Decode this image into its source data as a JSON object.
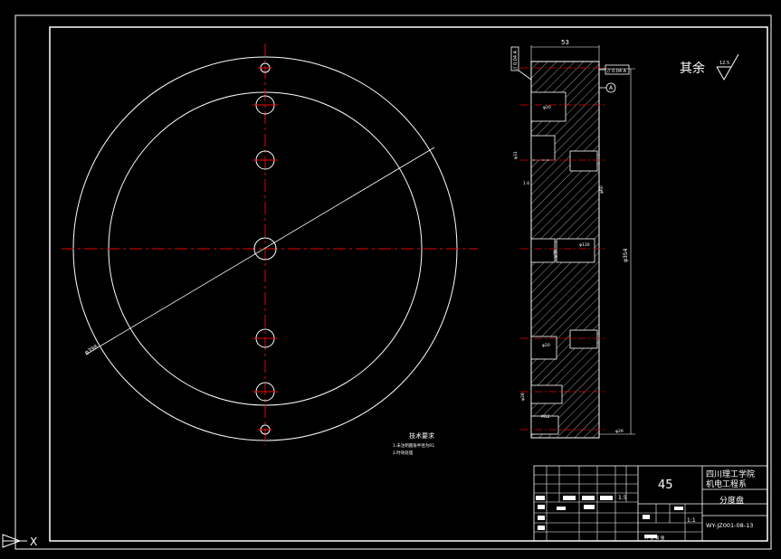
{
  "drawing": {
    "roughness_label": "其余",
    "roughness_value": "12.5",
    "dim_top_width": "53",
    "dim_dia_outer": "φ398",
    "dim_height_total": "φ354",
    "tolerance_frame_1": "// 0.04 A",
    "tolerance_frame_2": "// 0.04 A",
    "datum_label": "A",
    "dim_label_1": "φ20",
    "dim_label_2": "φ31",
    "dim_label_3": "φ60",
    "dim_label_4": "φ30",
    "dim_label_5": "φ130",
    "dim_label_6": "1.6",
    "dim_label_7": "φ20",
    "dim_label_8": "φ28",
    "dim_label_9": "M12",
    "dim_label_10": "φ29"
  },
  "notes": {
    "title": "技术要求",
    "line_1": "1.未注明圆角半径为R1",
    "line_2": "2.时效处理"
  },
  "title_block": {
    "material": "45",
    "school": "四川理工学院",
    "department": "机电工程系",
    "part_name": "分度盘",
    "drawing_no": "WY-JZ001-08-13",
    "scale": "1:1",
    "weight_label": "共 张 第 张",
    "mass": "1.5"
  },
  "axis_indicator": {
    "x_label": "X"
  }
}
